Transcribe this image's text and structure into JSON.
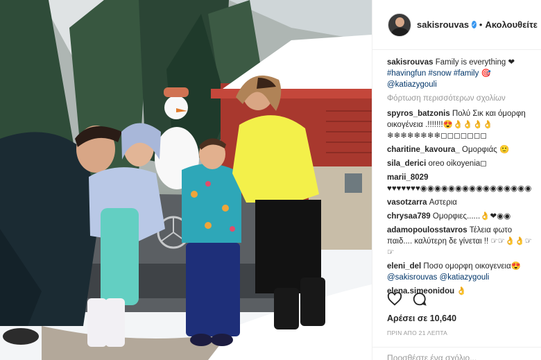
{
  "header": {
    "username": "sakisrouvas",
    "separator": "•",
    "follow_label": "Ακολουθείτε",
    "verified_icon": "✓"
  },
  "caption": {
    "username": "sakisrouvas",
    "text": "Family is everything ❤",
    "hashtags": "#havingfun #snow #family",
    "emoji": "🎯",
    "mention": "@katiazygouli"
  },
  "load_more": "Φόρτωση περισσότερων σχολίων",
  "comments": [
    {
      "user": "spyros_batzonis",
      "text": "Πολύ Σικ και όμορφη οικογένεια .!!!!!!!😍👌👌👌👌 ❄❄❄❄❄❄❄❄◻◻◻◻◻◻◻"
    },
    {
      "user": "charitine_kavoura_",
      "text": "Ομορφιάς 🙂"
    },
    {
      "user": "sila_derici",
      "text": "oreo oikoyenia◻"
    },
    {
      "user": "marii_8029",
      "text": "♥♥♥♥♥♥♥◉◉◉◉◉◉◉◉◉◉◉◉◉◉◉◉"
    },
    {
      "user": "vasotzarra",
      "text": "Αστερια"
    },
    {
      "user": "chrysaa789",
      "text": "Ομορφιες......👌❤◉◉"
    },
    {
      "user": "adamopoulosstavros",
      "text": "Τέλεια φωτο παιδ.... καλύτερη δε γίνεται !! ☞☞👌👌☞☞"
    },
    {
      "user": "eleni_del",
      "text": "Ποσο ομορφη οικογενεια😍",
      "mentions": "@sakisrouvas @katiazygouli"
    },
    {
      "user": "elena.simeonidou",
      "text": "👌"
    }
  ],
  "actions": {
    "like_icon": "heart-icon",
    "comment_icon": "comment-icon"
  },
  "likes": "Αρέσει σε 10,640",
  "timestamp": "ΠΡΙΝ ΑΠΟ 21 ΛΕΠΤΑ",
  "add_comment_placeholder": "Προσθέστε ένα σχόλιο..."
}
